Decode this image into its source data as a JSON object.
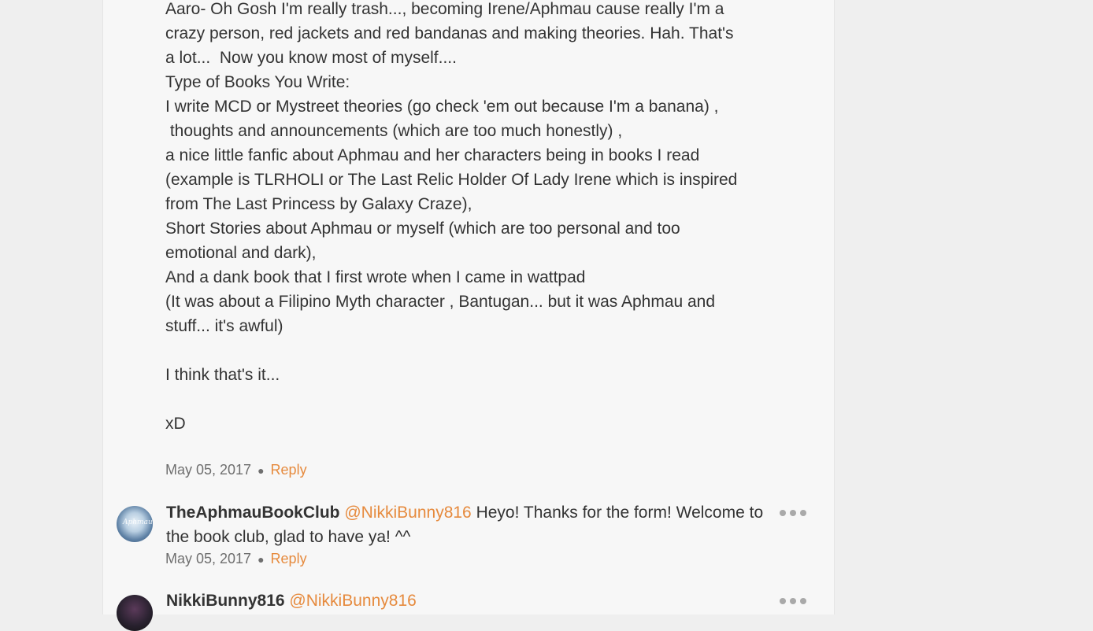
{
  "post": {
    "lines": [
      "Aaro- Oh Gosh I'm really trash..., becoming Irene/Aphmau cause really I'm a",
      "crazy person, red jackets and red bandanas and making theories. Hah. That's",
      "a lot...  Now you know most of myself....",
      "Type of Books You Write:",
      "I write MCD or Mystreet theories (go check 'em out because I'm a banana) ,",
      " thoughts and announcements (which are too much honestly) ,",
      "a nice little fanfic about Aphmau and her characters being in books I read",
      "(example is TLRHOLI or The Last Relic Holder Of Lady Irene which is inspired",
      "from The Last Princess by Galaxy Craze),",
      "Short Stories about Aphmau or myself (which are too personal and too",
      "emotional and dark),",
      "And a dank book that I first wrote when I came in wattpad",
      "(It was about a Filipino Myth character , Bantugan... but it was Aphmau and",
      "stuff... it's awful)",
      "",
      "I think that's it...",
      "",
      "xD"
    ],
    "date": "May 05, 2017",
    "reply_label": "Reply"
  },
  "comments": [
    {
      "username": "TheAphmauBookClub",
      "mention": "@NikkiBunny816",
      "text": " Heyo! Thanks for the form! Welcome to the book club, glad to have ya! ^^",
      "date": "May 05, 2017",
      "reply_label": "Reply",
      "avatar_text": "Aphmau"
    },
    {
      "username": "NikkiBunny816",
      "mention": "@NikkiBunny816",
      "text": ""
    }
  ],
  "colors": {
    "accent": "#e68a3d",
    "text": "#333333",
    "meta": "#6f6f6f",
    "panel": "#f7f7f7",
    "background": "#efefef"
  },
  "icons": {
    "more": "more-horizontal-icon"
  }
}
